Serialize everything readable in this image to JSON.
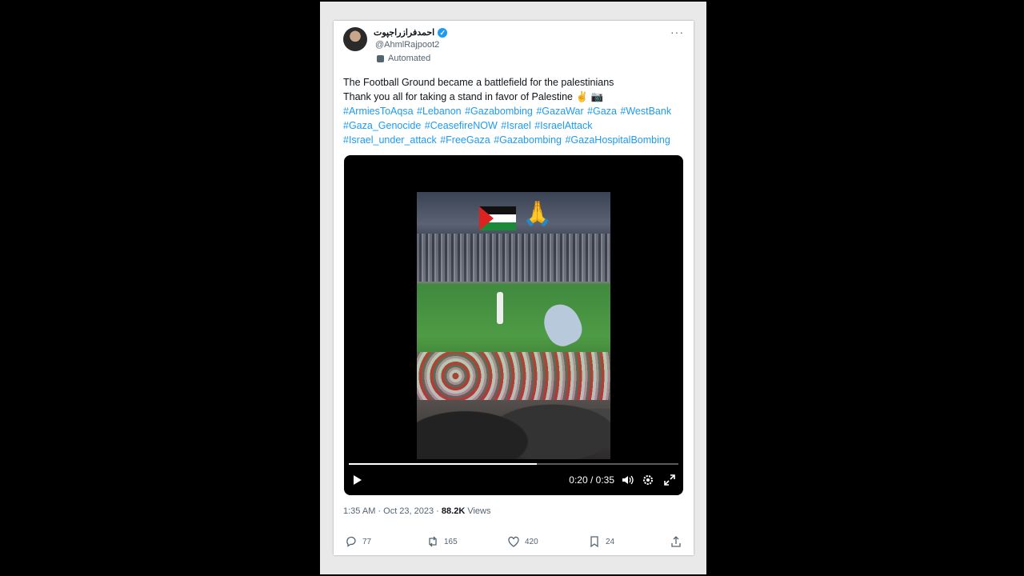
{
  "tweet": {
    "display_name": "احمدفرازراجپوت",
    "handle": "@AhmlRajpoot2",
    "automated_label": "Automated",
    "more_label": "···",
    "lines": [
      "The Football Ground became a battlefield for the palestinians",
      "Thank you all for taking a stand in favor of Palestine ✌️ 📷"
    ],
    "hashtag_lines": [
      "#ArmiesToAqsa #Lebanon #Gazabombing #GazaWar #Gaza #WestBank",
      "#Gaza_Genocide #CeasefireNOW #Israel #IsraelAttack",
      "#Israel_under_attack #FreeGaza #Gazabombing #GazaHospitalBombing"
    ],
    "colors": {
      "link": "#1d9bf0",
      "verified": "#1d9bf0"
    }
  },
  "video": {
    "time_display": "0:20 / 0:35",
    "progress": 0.57
  },
  "meta": {
    "timestamp": "1:35 AM · Oct 23, 2023 · ",
    "views_count": "88.2K",
    "views_label": " Views"
  },
  "actions": {
    "replies": "77",
    "reposts": "165",
    "likes": "420",
    "bookmarks": "24"
  }
}
